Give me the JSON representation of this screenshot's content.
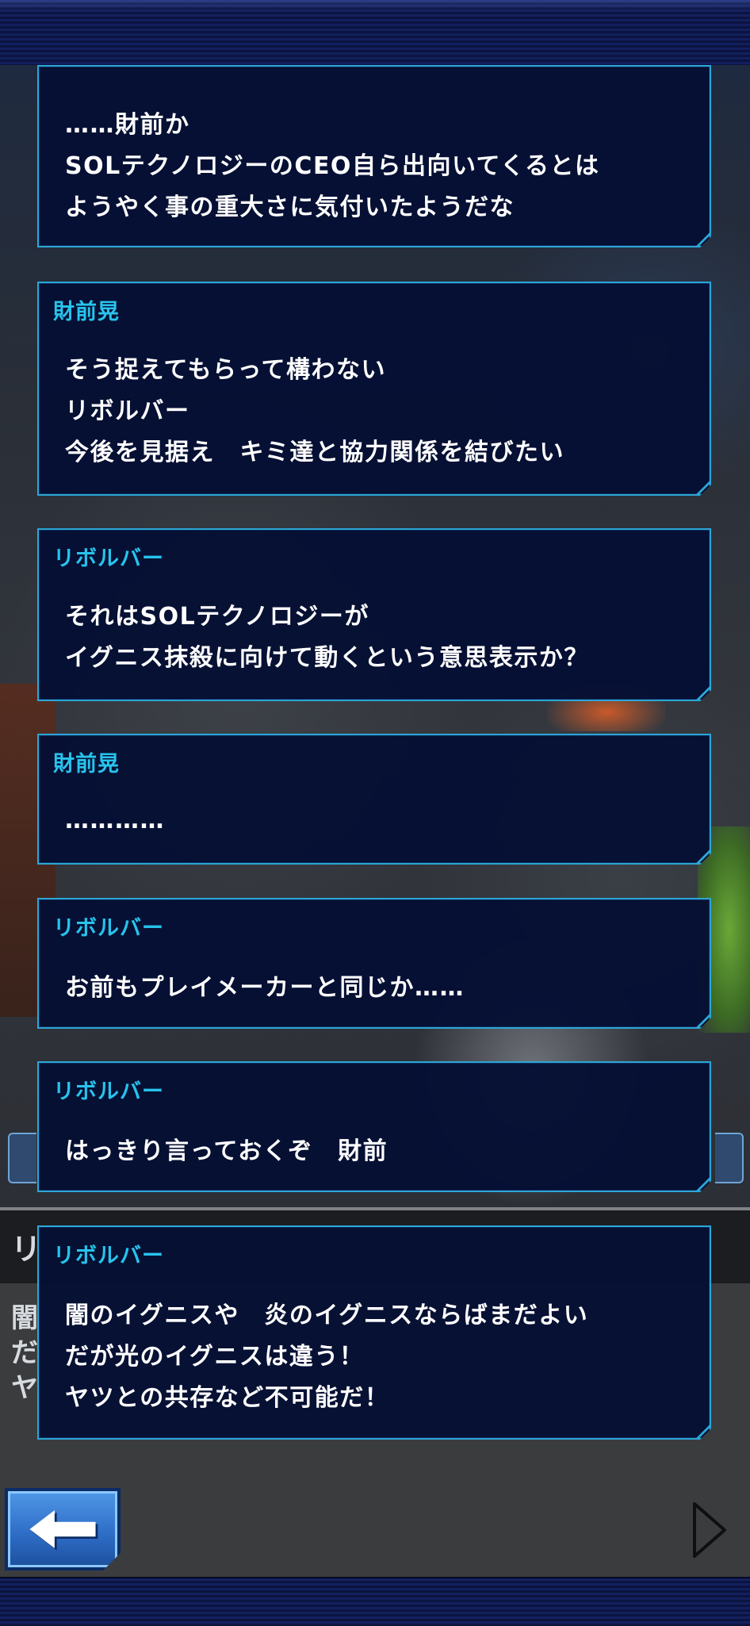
{
  "dialogs": [
    {
      "speaker": "",
      "lines": [
        "……財前か",
        "SOLテクノロジーのCEO自ら出向いてくるとは",
        "ようやく事の重大さに気付いたようだな"
      ]
    },
    {
      "speaker": "財前晃",
      "lines": [
        "そう捉えてもらって構わない",
        "リボルバー",
        "今後を見据え　キミ達と協力関係を結びたい"
      ]
    },
    {
      "speaker": "リボルバー",
      "lines": [
        "それはSOLテクノロジーが",
        "イグニス抹殺に向けて動くという意思表示か？"
      ]
    },
    {
      "speaker": "財前晃",
      "lines": [
        "…………"
      ]
    },
    {
      "speaker": "リボルバー",
      "lines": [
        "お前もプレイメーカーと同じか……"
      ]
    },
    {
      "speaker": "リボルバー",
      "lines": [
        "はっきり言っておくぞ　財前"
      ]
    },
    {
      "speaker": "リボルバー",
      "lines": [
        "闇のイグニスや　炎のイグニスならばまだよい",
        "だが光のイグニスは違う！",
        "ヤツとの共存など不可能だ！"
      ]
    }
  ],
  "background_text": {
    "header_glyph": "リ",
    "side_glyphs": [
      "闇",
      "だ",
      "ヤ"
    ]
  },
  "colors": {
    "speaker_name": "#27c3ec",
    "dialog_text": "#ffffff",
    "dialog_bg": "#051034",
    "dialog_border": "#2ba6d6",
    "back_button": "#2f6ec8",
    "top_bar": "#13205e"
  },
  "icons": {
    "back": "left-arrow-icon",
    "next": "play-triangle-icon"
  }
}
